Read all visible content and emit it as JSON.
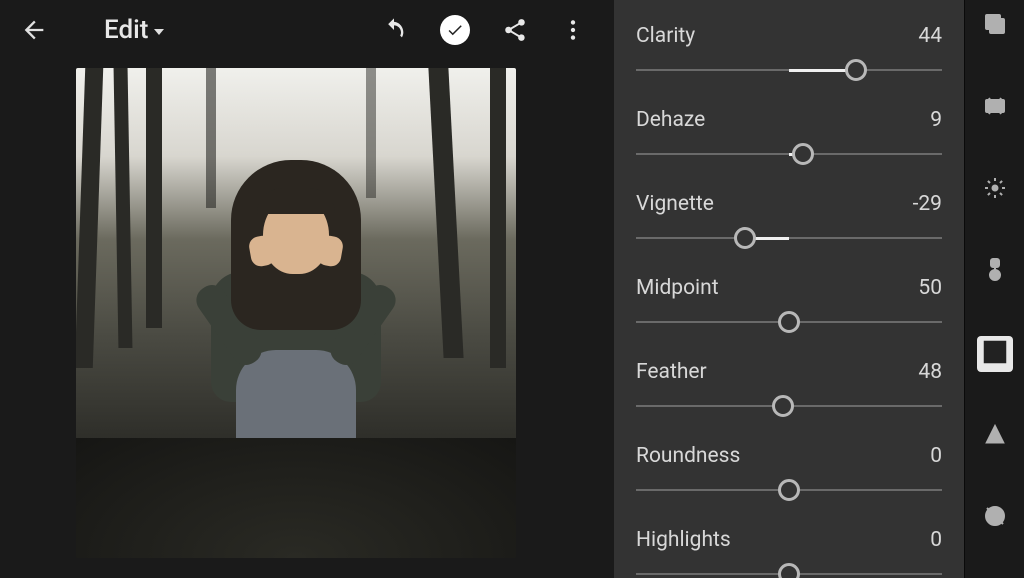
{
  "header": {
    "title": "Edit"
  },
  "sliders": [
    {
      "label": "Clarity",
      "value": "44",
      "min": -100,
      "max": 100,
      "percent": 72,
      "mid": 50
    },
    {
      "label": "Dehaze",
      "value": "9",
      "min": -100,
      "max": 100,
      "percent": 54.5,
      "mid": 50
    },
    {
      "label": "Vignette",
      "value": "-29",
      "min": -100,
      "max": 100,
      "percent": 35.5,
      "mid": 50
    },
    {
      "label": "Midpoint",
      "value": "50",
      "min": 0,
      "max": 100,
      "percent": 50,
      "mid": 50
    },
    {
      "label": "Feather",
      "value": "48",
      "min": 0,
      "max": 100,
      "percent": 48,
      "mid": 50
    },
    {
      "label": "Roundness",
      "value": "0",
      "min": -100,
      "max": 100,
      "percent": 50,
      "mid": 50
    },
    {
      "label": "Highlights",
      "value": "0",
      "min": -100,
      "max": 100,
      "percent": 50,
      "mid": 50
    }
  ],
  "tools": [
    {
      "name": "presets-icon",
      "active": false
    },
    {
      "name": "auto-icon",
      "active": false
    },
    {
      "name": "light-icon",
      "active": false
    },
    {
      "name": "color-icon",
      "active": false
    },
    {
      "name": "effects-icon",
      "active": true
    },
    {
      "name": "detail-icon",
      "active": false
    },
    {
      "name": "optics-icon",
      "active": false
    }
  ]
}
